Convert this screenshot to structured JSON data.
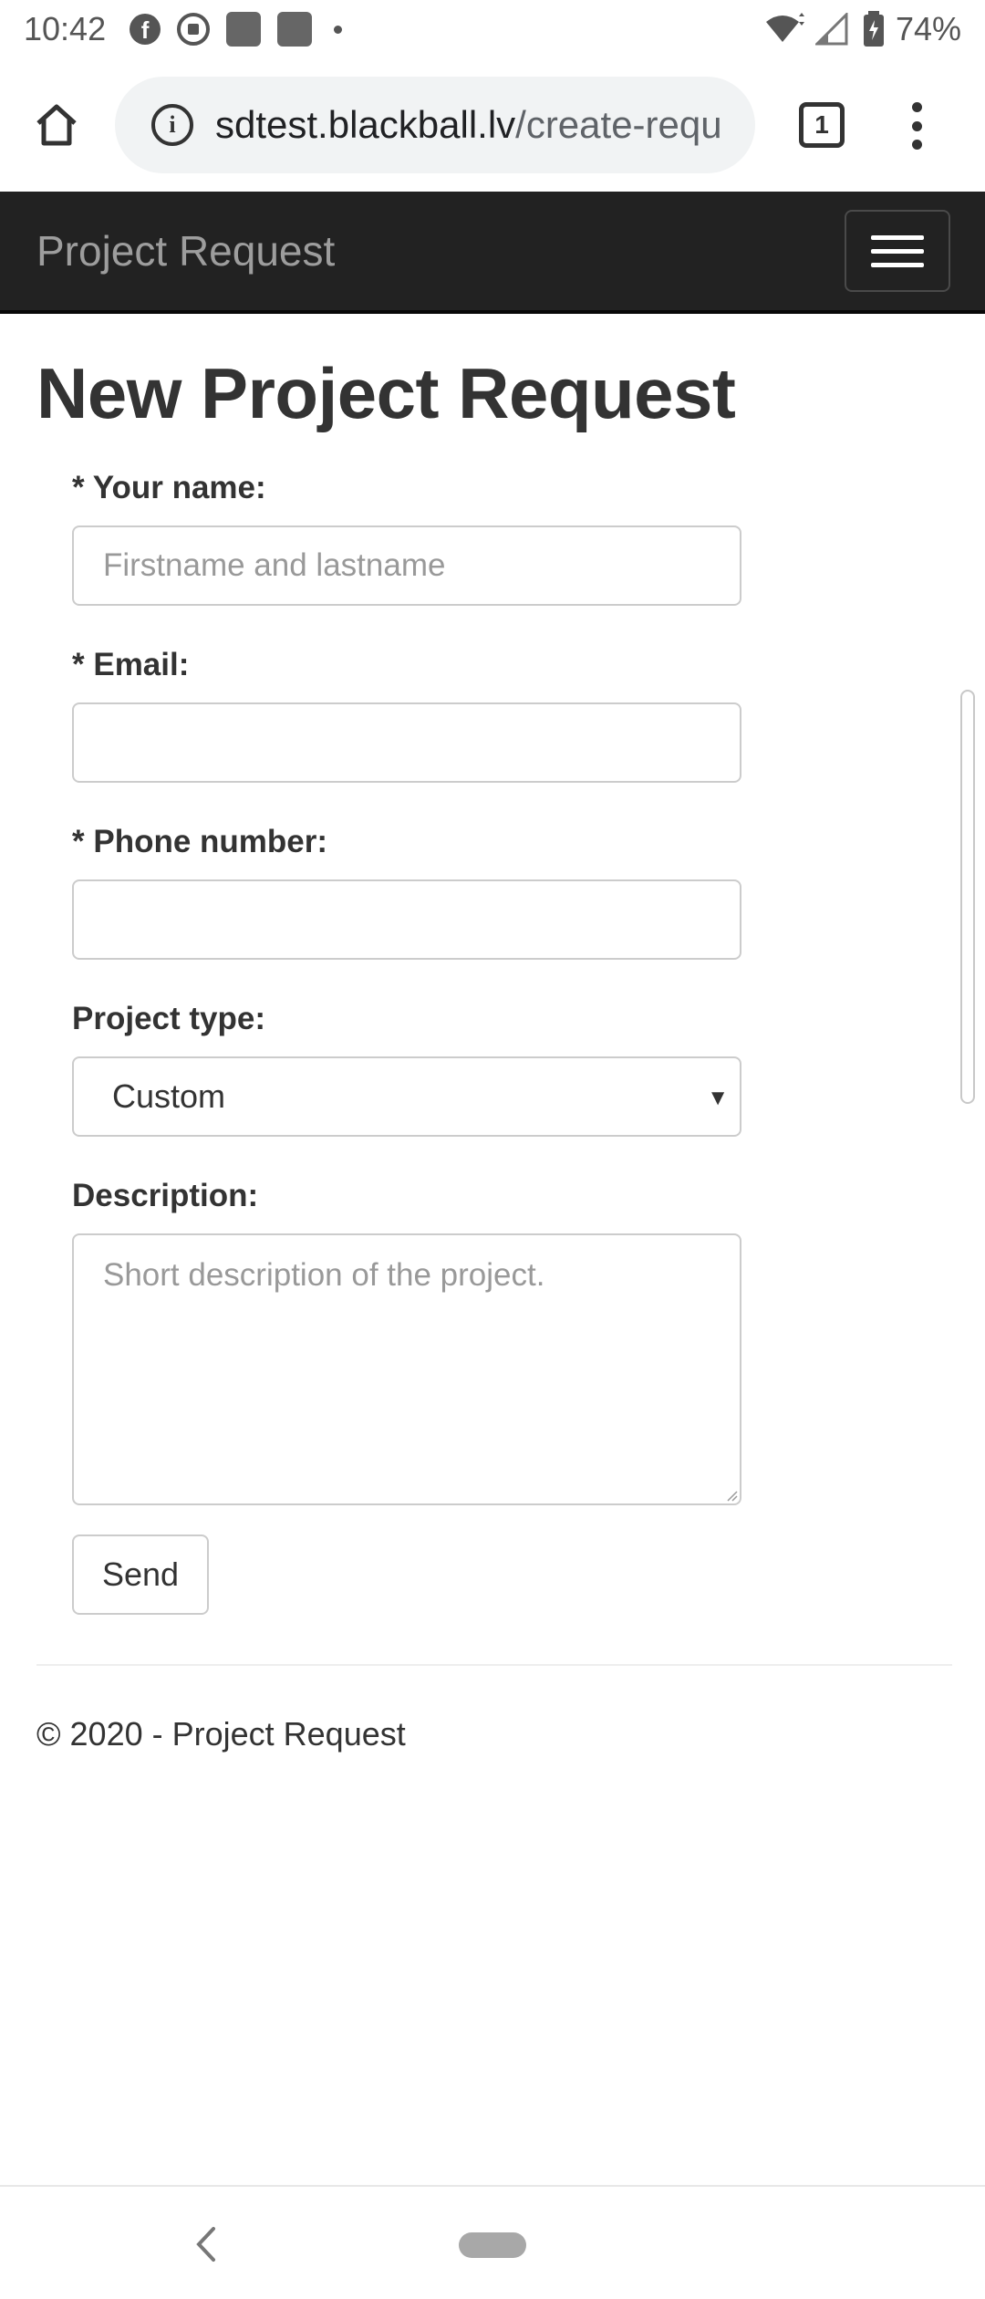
{
  "status_bar": {
    "time": "10:42",
    "notification_icons": [
      "facebook-icon",
      "soccer-ball-icon",
      "app-icon",
      "app-icon",
      "more-dot-icon"
    ],
    "battery_percent": "74%"
  },
  "browser": {
    "url_domain": "sdtest.blackball.lv",
    "url_path": "/create-requ",
    "tab_count": "1"
  },
  "navbar": {
    "brand": "Project Request"
  },
  "page": {
    "title": "New Project Request"
  },
  "form": {
    "name": {
      "label": "* Your name:",
      "value": "",
      "placeholder": "Firstname and lastname"
    },
    "email": {
      "label": "* Email:",
      "value": "",
      "placeholder": ""
    },
    "phone": {
      "label": "* Phone number:",
      "value": "",
      "placeholder": ""
    },
    "project_type": {
      "label": "Project type:",
      "selected": "Custom"
    },
    "description": {
      "label": "Description:",
      "value": "",
      "placeholder": "Short description of the project."
    },
    "send_label": "Send"
  },
  "footer": {
    "text": "© 2020 - Project Request"
  }
}
